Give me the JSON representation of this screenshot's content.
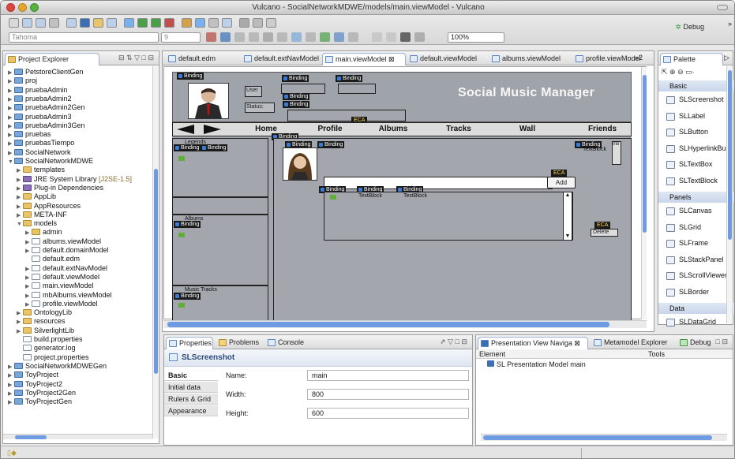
{
  "window": {
    "title": "Vulcano - SocialNetworkMDWE/models/main.viewModel - Vulcano"
  },
  "toolbar": {
    "font_combo": "Tahoma",
    "size_combo": "9",
    "zoom_combo": "100%",
    "debug_label": "Debug",
    "more_glyph": "»"
  },
  "explorer": {
    "tab_label": "Project Explorer",
    "items": [
      {
        "label": "PetstoreClientGen",
        "indent": 0,
        "icon": "project-folder-icon",
        "tw": "▶"
      },
      {
        "label": "proj",
        "indent": 0,
        "icon": "project-folder-icon",
        "tw": "▶"
      },
      {
        "label": "pruebaAdmin",
        "indent": 0,
        "icon": "project-folder-icon",
        "tw": "▶"
      },
      {
        "label": "pruebaAdmin2",
        "indent": 0,
        "icon": "project-folder-icon",
        "tw": "▶"
      },
      {
        "label": "pruebaAdmin2Gen",
        "indent": 0,
        "icon": "project-folder-icon",
        "tw": "▶"
      },
      {
        "label": "pruebaAdmin3",
        "indent": 0,
        "icon": "project-folder-icon",
        "tw": "▶"
      },
      {
        "label": "pruebaAdmin3Gen",
        "indent": 0,
        "icon": "project-folder-icon",
        "tw": "▶"
      },
      {
        "label": "pruebas",
        "indent": 0,
        "icon": "project-folder-icon",
        "tw": "▶"
      },
      {
        "label": "pruebasTiempo",
        "indent": 0,
        "icon": "project-folder-icon",
        "tw": "▶"
      },
      {
        "label": "SocialNetwork",
        "indent": 0,
        "icon": "project-folder-icon",
        "tw": "▶"
      },
      {
        "label": "SocialNetworkMDWE",
        "indent": 0,
        "icon": "project-folder-icon",
        "tw": "▼"
      },
      {
        "label": "templates",
        "indent": 1,
        "icon": "folder-icon",
        "tw": "▶"
      },
      {
        "label": "JRE System Library",
        "suffix": "[J2SE-1.5]",
        "indent": 1,
        "icon": "library-icon",
        "tw": "▶"
      },
      {
        "label": "Plug-in Dependencies",
        "indent": 1,
        "icon": "library-icon",
        "tw": "▶"
      },
      {
        "label": "AppLib",
        "indent": 1,
        "icon": "folder-icon",
        "tw": "▶"
      },
      {
        "label": "AppResources",
        "indent": 1,
        "icon": "folder-icon",
        "tw": "▶"
      },
      {
        "label": "META-INF",
        "indent": 1,
        "icon": "folder-icon",
        "tw": "▶"
      },
      {
        "label": "models",
        "indent": 1,
        "icon": "folder-icon",
        "tw": "▼"
      },
      {
        "label": "admin",
        "indent": 2,
        "icon": "folder-icon",
        "tw": "▶"
      },
      {
        "label": "albums.viewModel",
        "indent": 2,
        "icon": "file-icon",
        "tw": "▶"
      },
      {
        "label": "default.domainModel",
        "indent": 2,
        "icon": "file-icon",
        "tw": "▶"
      },
      {
        "label": "default.edm",
        "indent": 2,
        "icon": "file-icon",
        "tw": ""
      },
      {
        "label": "default.extNavModel",
        "indent": 2,
        "icon": "file-icon",
        "tw": "▶"
      },
      {
        "label": "default.viewModel",
        "indent": 2,
        "icon": "file-icon",
        "tw": "▶"
      },
      {
        "label": "main.viewModel",
        "indent": 2,
        "icon": "file-icon",
        "tw": "▶"
      },
      {
        "label": "mbAlbums.viewModel",
        "indent": 2,
        "icon": "file-icon",
        "tw": "▶"
      },
      {
        "label": "profile.viewModel",
        "indent": 2,
        "icon": "file-icon",
        "tw": "▶"
      },
      {
        "label": "OntologyLib",
        "indent": 1,
        "icon": "folder-icon",
        "tw": "▶"
      },
      {
        "label": "resources",
        "indent": 1,
        "icon": "folder-icon",
        "tw": "▶"
      },
      {
        "label": "SilverlightLib",
        "indent": 1,
        "icon": "folder-icon",
        "tw": "▶"
      },
      {
        "label": "build.properties",
        "indent": 1,
        "icon": "file-icon",
        "tw": ""
      },
      {
        "label": "generator.log",
        "indent": 1,
        "icon": "file-icon",
        "tw": ""
      },
      {
        "label": "project.properties",
        "indent": 1,
        "icon": "file-icon",
        "tw": ""
      },
      {
        "label": "SocialNetworkMDWEGen",
        "indent": 0,
        "icon": "project-folder-icon",
        "tw": "▶"
      },
      {
        "label": "ToyProject",
        "indent": 0,
        "icon": "project-folder-icon",
        "tw": "▶"
      },
      {
        "label": "ToyProject2",
        "indent": 0,
        "icon": "project-folder-icon",
        "tw": "▶"
      },
      {
        "label": "ToyProject2Gen",
        "indent": 0,
        "icon": "project-folder-icon",
        "tw": "▶"
      },
      {
        "label": "ToyProjectGen",
        "indent": 0,
        "icon": "project-folder-icon",
        "tw": "▶"
      }
    ]
  },
  "editor": {
    "tabs": [
      {
        "label": "default.edm",
        "active": false
      },
      {
        "label": "default.extNavModel",
        "active": false
      },
      {
        "label": "main.viewModel",
        "active": true,
        "close": "⊠"
      },
      {
        "label": "default.viewModel",
        "active": false
      },
      {
        "label": "albums.viewModel",
        "active": false
      },
      {
        "label": "profile.viewModel",
        "active": false
      }
    ],
    "overflow": "»2"
  },
  "design": {
    "app_title": "Social Music Manager",
    "binding": "Binding",
    "eca": "ECA",
    "user_label": "User",
    "status_label": "Status:",
    "nav": [
      "Home",
      "Profile",
      "Albums",
      "Tracks",
      "Wall",
      "Friends"
    ],
    "legends_label": "Legends",
    "albums_label": "Albums",
    "music_tracks_label": "Music Tracks",
    "textblock": "TextBlock",
    "add_button": "Add",
    "delete_button": "Delete",
    "mb_label": "mb"
  },
  "palette": {
    "title": "Palette",
    "sections": [
      {
        "name": "Basic",
        "items": [
          "SLScreenshot",
          "SLLabel",
          "SLButton",
          "SLHyperlinkBu...",
          "SLTextBox",
          "SLTextBlock"
        ]
      },
      {
        "name": "Panels",
        "items": [
          "SLCanvas",
          "SLGrid",
          "SLFrame",
          "SLStackPanel",
          "SLScrollViewer",
          "SLBorder"
        ]
      },
      {
        "name": "Data",
        "items": [
          "SLDataGrid",
          "SLDataGridTe...",
          "SLDataGridCh...",
          "SLDataGridTe..."
        ]
      }
    ]
  },
  "properties": {
    "tabs": [
      "Properties",
      "Problems",
      "Console"
    ],
    "selected": "SLScreenshot",
    "left_tabs": [
      "Basic",
      "Initial data",
      "Rulers & Grid",
      "Appearance"
    ],
    "fields": [
      {
        "label": "Name:",
        "value": "main"
      },
      {
        "label": "Width:",
        "value": "800"
      },
      {
        "label": "Height:",
        "value": "600"
      }
    ]
  },
  "presentation": {
    "tabs": [
      "Presentation View Naviga",
      "Metamodel Explorer",
      "Debug"
    ],
    "col_element": "Element",
    "col_tools": "Tools",
    "root": "SL Presentation Model main"
  },
  "status": {
    "glyph": "▯◆"
  }
}
